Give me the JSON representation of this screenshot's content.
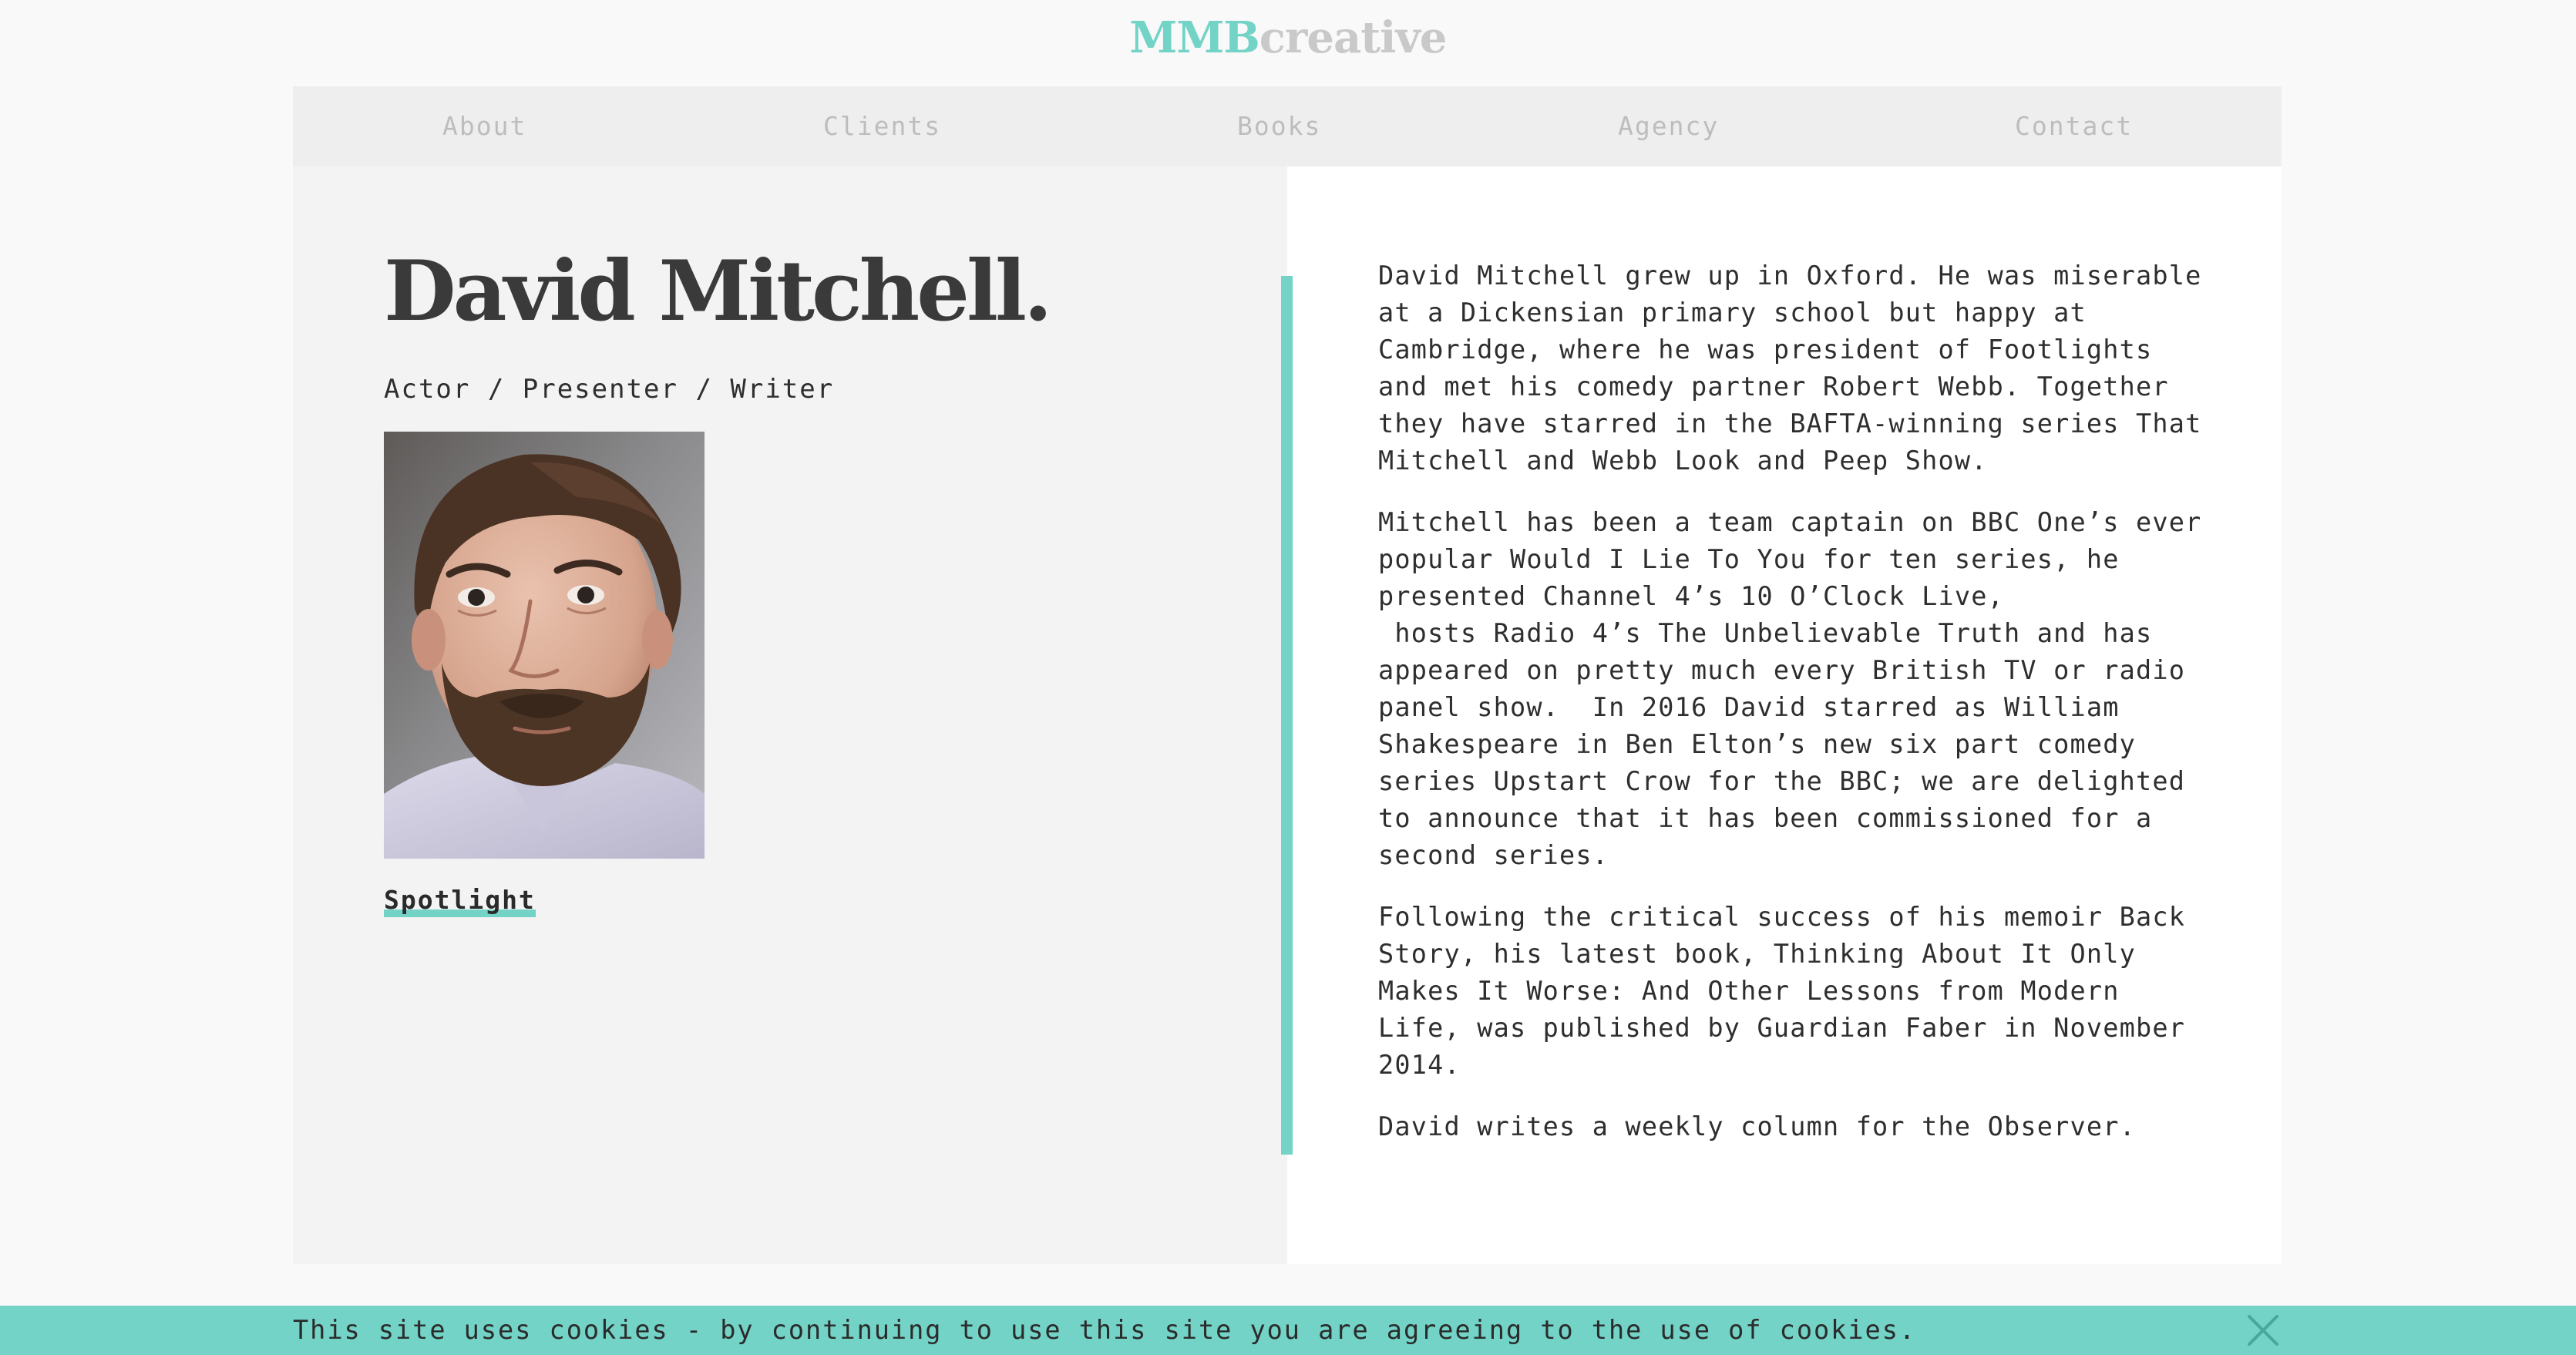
{
  "brand": {
    "logo_part1": "MMB",
    "logo_part2": "creative",
    "accent_color": "#72d3c6"
  },
  "nav": {
    "items": [
      {
        "label": "About"
      },
      {
        "label": "Clients"
      },
      {
        "label": "Books"
      },
      {
        "label": "Agency"
      },
      {
        "label": "Contact"
      }
    ]
  },
  "profile": {
    "name": "David Mitchell.",
    "roles": "Actor / Presenter / Writer",
    "spotlight_label": "Spotlight"
  },
  "bio": {
    "paragraphs": [
      "David Mitchell grew up in Oxford. He was miserable at a Dickensian primary school but happy at Cambridge, where he was president of Footlights and met his comedy partner Robert Webb. Together they have starred in the BAFTA-winning series That Mitchell and Webb Look and Peep Show.",
      "Mitchell has been a team captain on BBC One’s ever popular Would I Lie To You for ten series, he presented Channel 4’s 10 O’Clock Live,\n hosts Radio 4’s The Unbelievable Truth and has appeared on pretty much every British TV or radio panel show.  In 2016 David starred as William Shakespeare in Ben Elton’s new six part comedy series Upstart Crow for the BBC; we are delighted to announce that it has been commissioned for a second series.",
      "Following the critical success of his memoir Back Story, his latest book, Thinking About It Only Makes It Worse: And Other Lessons from Modern Life, was published by Guardian Faber in November 2014.",
      "David writes a weekly column for the Observer."
    ]
  },
  "cookie_banner": {
    "text": "This site uses cookies - by continuing to use this site you are agreeing to the use of cookies.",
    "close_icon": "close-icon"
  }
}
